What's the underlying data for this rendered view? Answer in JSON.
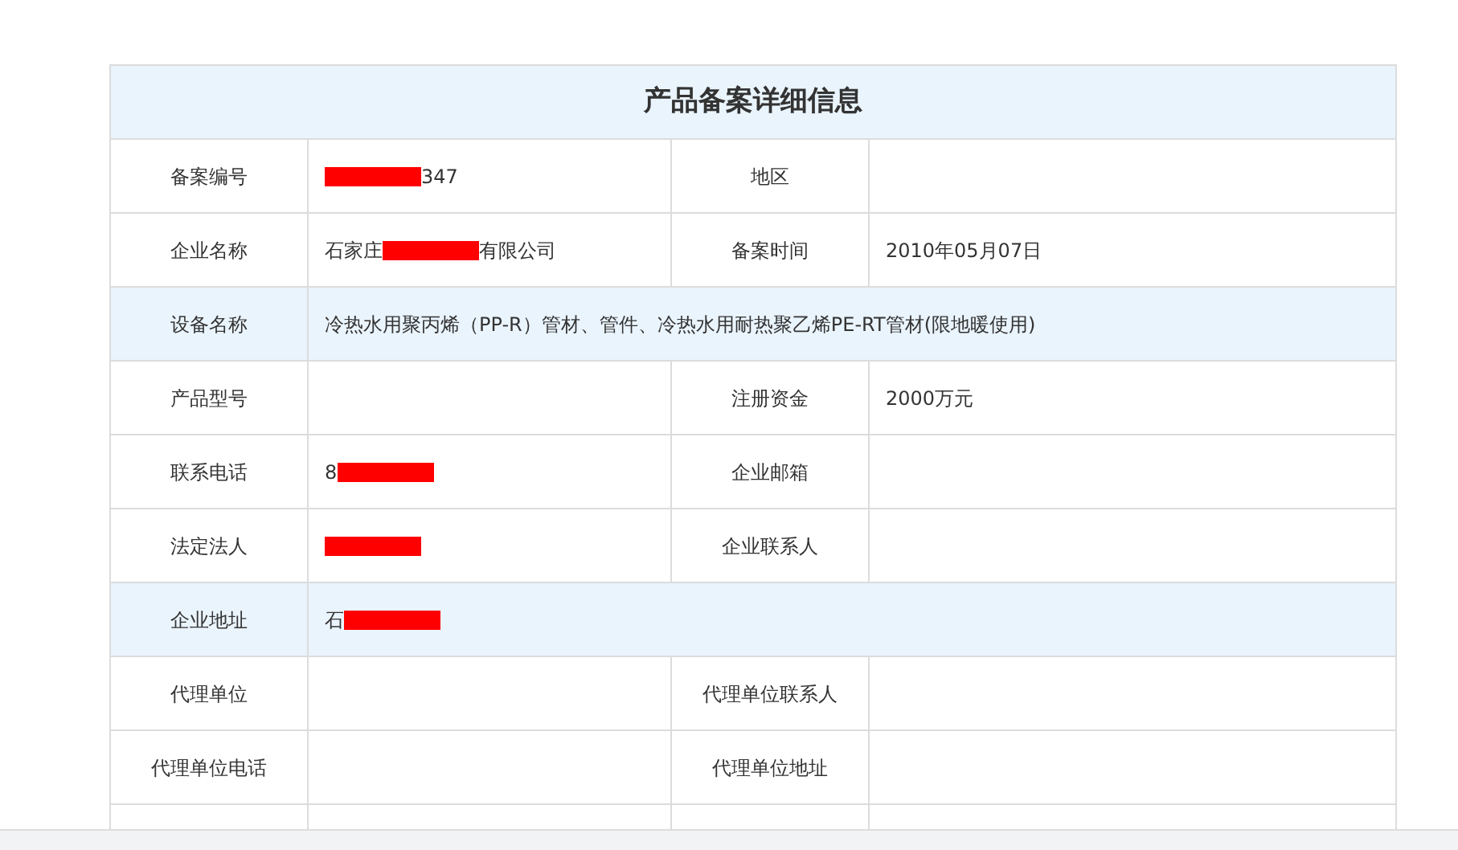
{
  "title": "产品备案详细信息",
  "rows": [
    {
      "kind": "pair",
      "highlight": false,
      "cells": [
        {
          "label": "备案编号",
          "value": [
            {
              "kind": "redacted"
            },
            {
              "kind": "text",
              "text": "347"
            }
          ]
        },
        {
          "label": "地区"
        }
      ]
    },
    {
      "kind": "pair",
      "highlight": false,
      "cells": [
        {
          "label": "企业名称",
          "value": [
            {
              "kind": "text",
              "text": "石家庄"
            },
            {
              "kind": "redacted"
            },
            {
              "kind": "text",
              "text": "有限公司"
            }
          ]
        },
        {
          "label": "备案时间",
          "value": [
            {
              "kind": "text",
              "text": "2010年05月07日"
            }
          ]
        }
      ]
    },
    {
      "kind": "wide",
      "highlight": true,
      "cells": [
        {
          "label": "设备名称",
          "value": [
            {
              "kind": "text",
              "text": "冷热水用聚丙烯（PP-R）管材、管件、冷热水用耐热聚乙烯PE-RT管材(限地暖使用)"
            }
          ]
        }
      ]
    },
    {
      "kind": "pair",
      "highlight": false,
      "cells": [
        {
          "label": "产品型号"
        },
        {
          "label": "注册资金",
          "value": [
            {
              "kind": "text",
              "text": "2000万元"
            }
          ]
        }
      ]
    },
    {
      "kind": "pair",
      "highlight": false,
      "cells": [
        {
          "label": "联系电话",
          "value": [
            {
              "kind": "text",
              "text": "8"
            },
            {
              "kind": "redacted"
            }
          ]
        },
        {
          "label": "企业邮箱"
        }
      ]
    },
    {
      "kind": "pair",
      "highlight": false,
      "cells": [
        {
          "label": "法定法人",
          "value": [
            {
              "kind": "redacted"
            }
          ]
        },
        {
          "label": "企业联系人"
        }
      ]
    },
    {
      "kind": "wide",
      "highlight": true,
      "cells": [
        {
          "label": "企业地址",
          "value": [
            {
              "kind": "text",
              "text": "石"
            },
            {
              "kind": "redacted"
            }
          ]
        }
      ]
    },
    {
      "kind": "pair",
      "highlight": false,
      "cells": [
        {
          "label": "代理单位"
        },
        {
          "label": "代理单位联系人"
        }
      ]
    },
    {
      "kind": "pair",
      "highlight": false,
      "cells": [
        {
          "label": "代理单位电话"
        },
        {
          "label": "代理单位地址"
        }
      ]
    }
  ]
}
